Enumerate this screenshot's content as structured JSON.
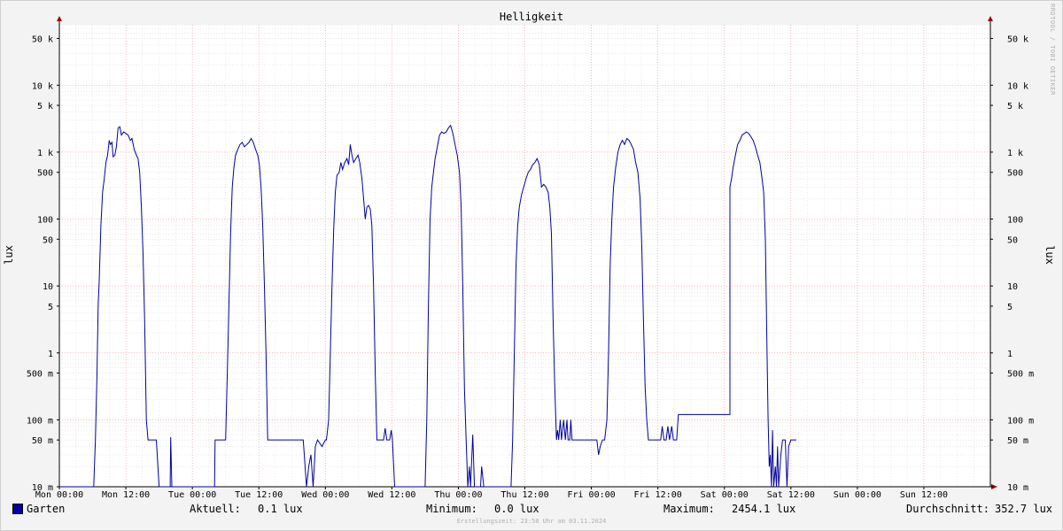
{
  "chart_data": {
    "type": "line",
    "title": "Helligkeit",
    "ylabel": "lux",
    "y_scale": "log",
    "ylim": [
      0.01,
      80000
    ],
    "y_ticks": [
      {
        "v": 0.01,
        "label": "10 m"
      },
      {
        "v": 0.05,
        "label": "50 m"
      },
      {
        "v": 0.1,
        "label": "100 m"
      },
      {
        "v": 0.5,
        "label": "500 m"
      },
      {
        "v": 1,
        "label": "1"
      },
      {
        "v": 5,
        "label": "5"
      },
      {
        "v": 10,
        "label": "10"
      },
      {
        "v": 50,
        "label": "50"
      },
      {
        "v": 100,
        "label": "100"
      },
      {
        "v": 500,
        "label": "500"
      },
      {
        "v": 1000,
        "label": "1 k"
      },
      {
        "v": 5000,
        "label": "5 k"
      },
      {
        "v": 10000,
        "label": "10 k"
      },
      {
        "v": 50000,
        "label": "50 k"
      }
    ],
    "x_ticks": [
      "Mon 00:00",
      "Mon 12:00",
      "Tue 00:00",
      "Tue 12:00",
      "Wed 00:00",
      "Wed 12:00",
      "Thu 00:00",
      "Thu 12:00",
      "Fri 00:00",
      "Fri 12:00",
      "Sat 00:00",
      "Sat 12:00",
      "Sun 00:00",
      "Sun 12:00"
    ],
    "xlim_hours": [
      0,
      168
    ],
    "grid": true,
    "legend_position": "bottom-left",
    "series": [
      {
        "name": "Garten",
        "color": "#0000a0",
        "points": [
          [
            0,
            0.01
          ],
          [
            6.2,
            0.01
          ],
          [
            6.5,
            0.05
          ],
          [
            6.8,
            0.5
          ],
          [
            7.0,
            5
          ],
          [
            7.2,
            12
          ],
          [
            7.5,
            80
          ],
          [
            7.8,
            250
          ],
          [
            8.1,
            400
          ],
          [
            8.4,
            700
          ],
          [
            8.7,
            900
          ],
          [
            9.0,
            1500
          ],
          [
            9.2,
            1300
          ],
          [
            9.5,
            1400
          ],
          [
            9.7,
            850
          ],
          [
            10.0,
            900
          ],
          [
            10.3,
            1200
          ],
          [
            10.6,
            2300
          ],
          [
            10.9,
            2400
          ],
          [
            11.2,
            1800
          ],
          [
            11.6,
            2000
          ],
          [
            12.0,
            1900
          ],
          [
            12.4,
            1800
          ],
          [
            12.8,
            1500
          ],
          [
            13.1,
            1600
          ],
          [
            13.5,
            1100
          ],
          [
            13.9,
            900
          ],
          [
            14.2,
            800
          ],
          [
            14.5,
            500
          ],
          [
            14.8,
            150
          ],
          [
            15.1,
            30
          ],
          [
            15.4,
            3
          ],
          [
            15.7,
            0.1
          ],
          [
            16.0,
            0.05
          ],
          [
            17.5,
            0.05
          ],
          [
            18.0,
            0.01
          ],
          [
            20.0,
            0.01
          ],
          [
            20.1,
            0.055
          ],
          [
            20.3,
            0.01
          ],
          [
            28.0,
            0.01
          ],
          [
            28.1,
            0.05
          ],
          [
            30.0,
            0.05
          ],
          [
            30.3,
            0.5
          ],
          [
            30.6,
            5
          ],
          [
            30.9,
            60
          ],
          [
            31.2,
            300
          ],
          [
            31.5,
            600
          ],
          [
            31.8,
            900
          ],
          [
            32.2,
            1100
          ],
          [
            32.6,
            1300
          ],
          [
            33.0,
            1400
          ],
          [
            33.4,
            1200
          ],
          [
            33.8,
            1300
          ],
          [
            34.2,
            1400
          ],
          [
            34.6,
            1600
          ],
          [
            35.0,
            1400
          ],
          [
            35.4,
            1100
          ],
          [
            35.8,
            900
          ],
          [
            36.1,
            650
          ],
          [
            36.4,
            300
          ],
          [
            36.7,
            80
          ],
          [
            37.0,
            10
          ],
          [
            37.3,
            1
          ],
          [
            37.6,
            0.05
          ],
          [
            44.0,
            0.05
          ],
          [
            44.2,
            0.03
          ],
          [
            44.6,
            0.01
          ],
          [
            45.0,
            0.02
          ],
          [
            45.4,
            0.03
          ],
          [
            45.8,
            0.01
          ],
          [
            46.2,
            0.04
          ],
          [
            46.6,
            0.05
          ],
          [
            47.4,
            0.04
          ],
          [
            48.0,
            0.05
          ],
          [
            48.2,
            0.05
          ],
          [
            48.6,
            0.1
          ],
          [
            48.9,
            1
          ],
          [
            49.2,
            10
          ],
          [
            49.5,
            70
          ],
          [
            49.8,
            250
          ],
          [
            50.1,
            450
          ],
          [
            50.5,
            500
          ],
          [
            50.8,
            700
          ],
          [
            51.1,
            550
          ],
          [
            51.5,
            700
          ],
          [
            51.9,
            800
          ],
          [
            52.2,
            650
          ],
          [
            52.5,
            1300
          ],
          [
            52.8,
            900
          ],
          [
            53.1,
            700
          ],
          [
            53.5,
            800
          ],
          [
            53.9,
            900
          ],
          [
            54.2,
            700
          ],
          [
            54.6,
            400
          ],
          [
            54.9,
            200
          ],
          [
            55.2,
            100
          ],
          [
            55.5,
            150
          ],
          [
            55.8,
            160
          ],
          [
            56.1,
            140
          ],
          [
            56.4,
            80
          ],
          [
            56.7,
            10
          ],
          [
            57.0,
            0.5
          ],
          [
            57.3,
            0.05
          ],
          [
            58.5,
            0.05
          ],
          [
            58.8,
            0.075
          ],
          [
            59.1,
            0.05
          ],
          [
            59.6,
            0.05
          ],
          [
            59.9,
            0.07
          ],
          [
            60.1,
            0.05
          ],
          [
            60.5,
            0.01
          ],
          [
            66.0,
            0.01
          ],
          [
            66.3,
            0.1
          ],
          [
            66.6,
            5
          ],
          [
            66.9,
            100
          ],
          [
            67.2,
            300
          ],
          [
            67.5,
            500
          ],
          [
            67.8,
            800
          ],
          [
            68.2,
            1200
          ],
          [
            68.6,
            1800
          ],
          [
            69.0,
            2000
          ],
          [
            69.4,
            1900
          ],
          [
            69.8,
            2000
          ],
          [
            70.2,
            2300
          ],
          [
            70.6,
            2500
          ],
          [
            71.0,
            1900
          ],
          [
            71.4,
            1300
          ],
          [
            71.8,
            900
          ],
          [
            72.2,
            500
          ],
          [
            72.5,
            150
          ],
          [
            72.8,
            10
          ],
          [
            73.1,
            0.3
          ],
          [
            73.4,
            0.05
          ],
          [
            73.7,
            0.01
          ],
          [
            74.0,
            0.02
          ],
          [
            74.2,
            0.01
          ],
          [
            74.6,
            0.06
          ],
          [
            74.9,
            0.01
          ],
          [
            76.0,
            0.01
          ],
          [
            76.2,
            0.02
          ],
          [
            76.6,
            0.01
          ],
          [
            81.5,
            0.01
          ],
          [
            81.8,
            0.05
          ],
          [
            82.1,
            1
          ],
          [
            82.4,
            20
          ],
          [
            82.7,
            80
          ],
          [
            83.0,
            150
          ],
          [
            83.4,
            230
          ],
          [
            83.8,
            300
          ],
          [
            84.2,
            400
          ],
          [
            84.6,
            500
          ],
          [
            85.0,
            550
          ],
          [
            85.4,
            650
          ],
          [
            85.8,
            700
          ],
          [
            86.2,
            800
          ],
          [
            86.6,
            650
          ],
          [
            87.0,
            300
          ],
          [
            87.4,
            330
          ],
          [
            87.8,
            300
          ],
          [
            88.2,
            250
          ],
          [
            88.5,
            150
          ],
          [
            88.8,
            60
          ],
          [
            89.1,
            3
          ],
          [
            89.4,
            0.3
          ],
          [
            89.7,
            0.05
          ],
          [
            89.9,
            0.07
          ],
          [
            90.1,
            0.05
          ],
          [
            90.4,
            0.1
          ],
          [
            90.6,
            0.05
          ],
          [
            91.0,
            0.1
          ],
          [
            91.3,
            0.05
          ],
          [
            91.6,
            0.1
          ],
          [
            91.8,
            0.05
          ],
          [
            92.1,
            0.05
          ],
          [
            92.3,
            0.1
          ],
          [
            92.5,
            0.05
          ],
          [
            97.0,
            0.05
          ],
          [
            97.3,
            0.03
          ],
          [
            97.6,
            0.04
          ],
          [
            98.0,
            0.05
          ],
          [
            98.4,
            0.05
          ],
          [
            98.8,
            0.1
          ],
          [
            99.1,
            1
          ],
          [
            99.4,
            20
          ],
          [
            99.7,
            100
          ],
          [
            100.0,
            300
          ],
          [
            100.4,
            600
          ],
          [
            100.8,
            1000
          ],
          [
            101.2,
            1300
          ],
          [
            101.6,
            1500
          ],
          [
            102.0,
            1300
          ],
          [
            102.4,
            1600
          ],
          [
            102.8,
            1500
          ],
          [
            103.2,
            1300
          ],
          [
            103.6,
            1100
          ],
          [
            104.0,
            700
          ],
          [
            104.4,
            500
          ],
          [
            104.8,
            200
          ],
          [
            105.1,
            40
          ],
          [
            105.4,
            3
          ],
          [
            105.7,
            0.3
          ],
          [
            106.0,
            0.1
          ],
          [
            106.3,
            0.05
          ],
          [
            108.5,
            0.05
          ],
          [
            108.8,
            0.08
          ],
          [
            109.1,
            0.05
          ],
          [
            109.5,
            0.05
          ],
          [
            109.8,
            0.08
          ],
          [
            110.1,
            0.05
          ],
          [
            110.5,
            0.08
          ],
          [
            110.8,
            0.05
          ],
          [
            111.4,
            0.05
          ],
          [
            111.7,
            0.12
          ],
          [
            121.0,
            0.12
          ],
          [
            121.0,
            300
          ],
          [
            121.3,
            400
          ],
          [
            121.6,
            600
          ],
          [
            122.0,
            900
          ],
          [
            122.4,
            1300
          ],
          [
            122.8,
            1500
          ],
          [
            123.2,
            1800
          ],
          [
            123.6,
            1900
          ],
          [
            124.0,
            2000
          ],
          [
            124.4,
            1900
          ],
          [
            124.8,
            1700
          ],
          [
            125.2,
            1500
          ],
          [
            125.6,
            1200
          ],
          [
            126.0,
            900
          ],
          [
            126.4,
            700
          ],
          [
            126.8,
            400
          ],
          [
            127.1,
            250
          ],
          [
            127.4,
            50
          ],
          [
            127.7,
            1
          ],
          [
            127.9,
            0.1
          ],
          [
            128.1,
            0.02
          ],
          [
            128.3,
            0.03
          ],
          [
            128.5,
            0.01
          ],
          [
            128.7,
            0.07
          ],
          [
            128.9,
            0.01
          ],
          [
            129.2,
            0.02
          ],
          [
            129.4,
            0.01
          ],
          [
            129.6,
            0.04
          ],
          [
            129.8,
            0.01
          ],
          [
            130.2,
            0.03
          ],
          [
            130.5,
            0.05
          ],
          [
            131.0,
            0.05
          ],
          [
            131.3,
            0.01
          ],
          [
            131.6,
            0.04
          ],
          [
            132.0,
            0.05
          ],
          [
            133.0,
            0.05
          ]
        ]
      }
    ]
  },
  "legend": {
    "series_name": "Garten",
    "current_label": "Aktuell:",
    "current_value": "0.1 lux",
    "min_label": "Minimum:",
    "min_value": "0.0 lux",
    "max_label": "Maximum:",
    "max_value": "2454.1 lux",
    "avg_label": "Durchschnitt:",
    "avg_value": "352.7 lux"
  },
  "footer_text": "Erstellungszeit: 23:58 Uhr am 03.11.2024",
  "watermark": "RRDTOOL / TOBI OETIKER",
  "colors": {
    "background": "#f3f3f3",
    "plot_background": "#ffffff",
    "series": "#0000a0",
    "grid_minor": "#dcdcdc",
    "grid_major": "#f0a0a0",
    "axis": "#000000",
    "arrow": "#a00000"
  }
}
